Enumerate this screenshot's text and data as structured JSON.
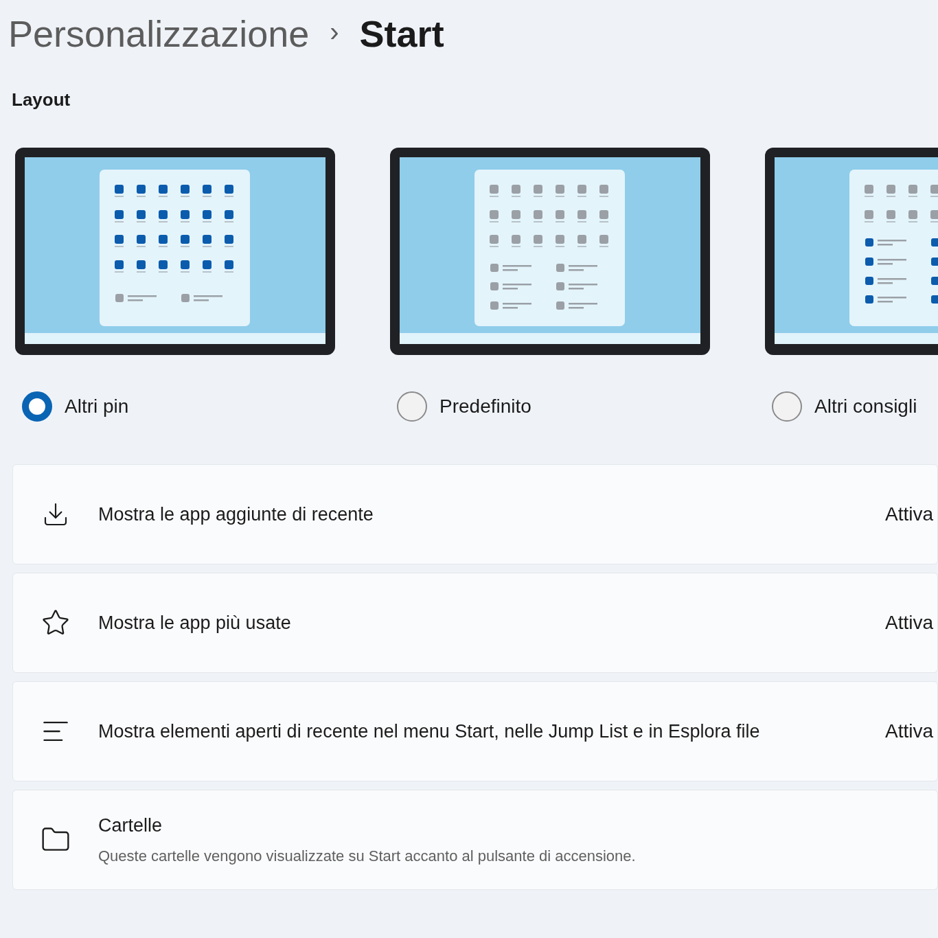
{
  "breadcrumb": {
    "parent": "Personalizzazione",
    "separator": "›",
    "current": "Start"
  },
  "layout_section": {
    "title": "Layout",
    "options": [
      {
        "label": "Altri pin",
        "kind": "more_pins",
        "selected": true
      },
      {
        "label": "Predefinito",
        "kind": "default",
        "selected": false
      },
      {
        "label": "Altri consigli",
        "kind": "more_recommendations",
        "selected": false
      }
    ]
  },
  "settings": [
    {
      "kind": "download",
      "title": "Mostra le app aggiunte di recente",
      "value": "Attiva"
    },
    {
      "kind": "star",
      "title": "Mostra le app più usate",
      "value": "Attiva"
    },
    {
      "kind": "list",
      "title": "Mostra elementi aperti di recente nel menu Start, nelle Jump List e in Esplora file",
      "value": "Attiva"
    },
    {
      "kind": "folder",
      "title": "Cartelle",
      "subtitle": "Queste cartelle vengono visualizzate su Start accanto al pulsante di accensione."
    }
  ]
}
